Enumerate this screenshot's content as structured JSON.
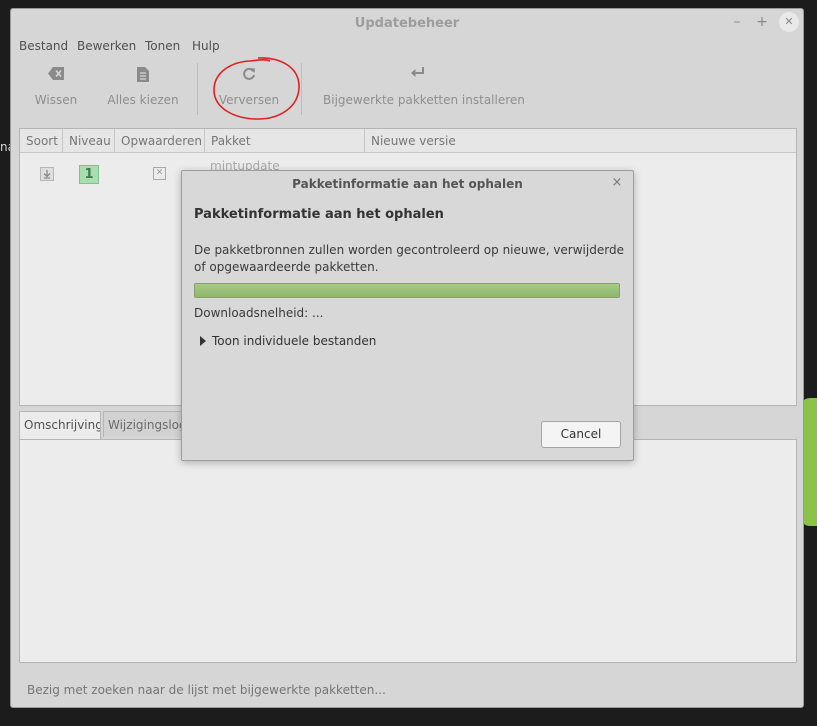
{
  "desktop": {
    "fragment": "na"
  },
  "window": {
    "title": "Updatebeheer",
    "minimize": "–",
    "maximize": "+",
    "close": "✕"
  },
  "menu": [
    "Bestand",
    "Bewerken",
    "Tonen",
    "Hulp"
  ],
  "toolbar": {
    "clear_label": "Wissen",
    "select_all_label": "Alles kiezen",
    "refresh_label": "Verversen",
    "install_label": "Bijgewerkte pakketten installeren"
  },
  "table": {
    "columns": [
      "Soort",
      "Niveau",
      "Opwaarderen",
      "Pakket",
      "Nieuwe versie"
    ],
    "rows": [
      {
        "level": "1",
        "package": "mintupdate"
      }
    ]
  },
  "tabs": [
    "Omschrijving",
    "Wijzigingslogboek"
  ],
  "status_text": "Bezig met zoeken naar de lijst met bijgewerkte pakketten...",
  "dialog": {
    "title": "Pakketinformatie aan het ophalen",
    "heading": "Pakketinformatie aan het ophalen",
    "description": "De pakketbronnen zullen worden gecontroleerd op nieuwe, verwijderde of opgewaardeerde pakketten.",
    "progress_percent": 100,
    "speed": "Downloadsnelheid: ...",
    "expander_label": "Toon individuele bestanden",
    "cancel_label": "Cancel",
    "close": "×"
  },
  "colors": {
    "progress": "#99c174",
    "level_badge": "#a9dfb0",
    "annotation": "#e02020"
  }
}
